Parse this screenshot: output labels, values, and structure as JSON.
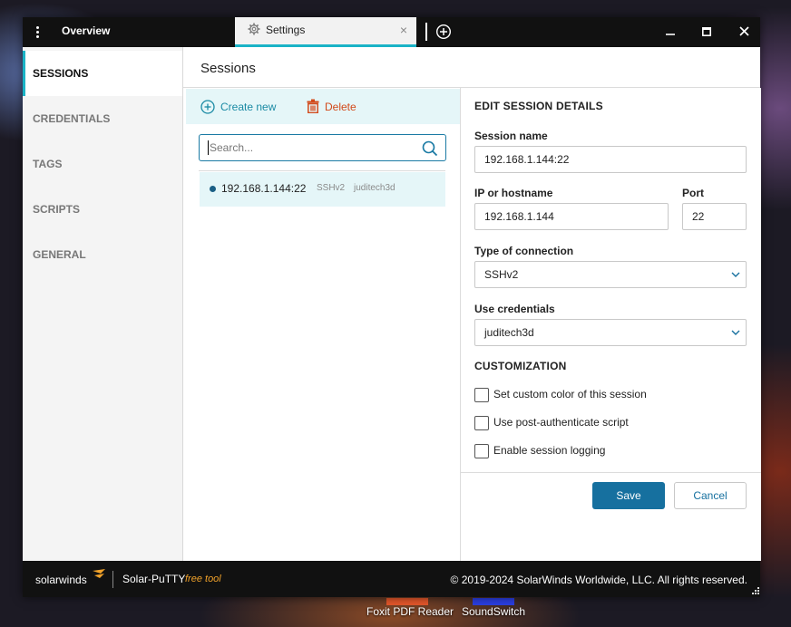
{
  "titlebar": {
    "overview_tab": "Overview",
    "settings_tab": "Settings",
    "accent_color": "#1ab3c6"
  },
  "sidebar": {
    "items": [
      {
        "label": "SESSIONS",
        "active": true
      },
      {
        "label": "CREDENTIALS",
        "active": false
      },
      {
        "label": "TAGS",
        "active": false
      },
      {
        "label": "SCRIPTS",
        "active": false
      },
      {
        "label": "GENERAL",
        "active": false
      }
    ]
  },
  "main": {
    "title": "Sessions",
    "create_label": "Create new",
    "delete_label": "Delete",
    "search_placeholder": "Search...",
    "sessions": [
      {
        "name": "192.168.1.144:22",
        "protocol": "SSHv2",
        "credential": "juditech3d"
      }
    ]
  },
  "details": {
    "heading": "EDIT SESSION DETAILS",
    "session_name_label": "Session name",
    "session_name_value": "192.168.1.144:22",
    "host_label": "IP or hostname",
    "host_value": "192.168.1.144",
    "port_label": "Port",
    "port_value": "22",
    "connection_label": "Type of connection",
    "connection_value": "SSHv2",
    "credentials_label": "Use credentials",
    "credentials_value": "juditech3d",
    "customization_heading": "CUSTOMIZATION",
    "options": [
      {
        "label": "Set custom color of this session",
        "checked": false
      },
      {
        "label": "Use post-authenticate script",
        "checked": false
      },
      {
        "label": "Enable session logging",
        "checked": false
      }
    ],
    "save_label": "Save",
    "cancel_label": "Cancel",
    "primary_color": "#16709f"
  },
  "footer": {
    "brand": "solarwinds",
    "product": "Solar-PuTTY",
    "tag": "free tool",
    "copyright": "© 2019-2024 SolarWinds Worldwide, LLC. All rights reserved."
  },
  "desktop": {
    "icons": [
      {
        "label": "Foxit PDF Reader"
      },
      {
        "label": "SoundSwitch"
      }
    ]
  }
}
